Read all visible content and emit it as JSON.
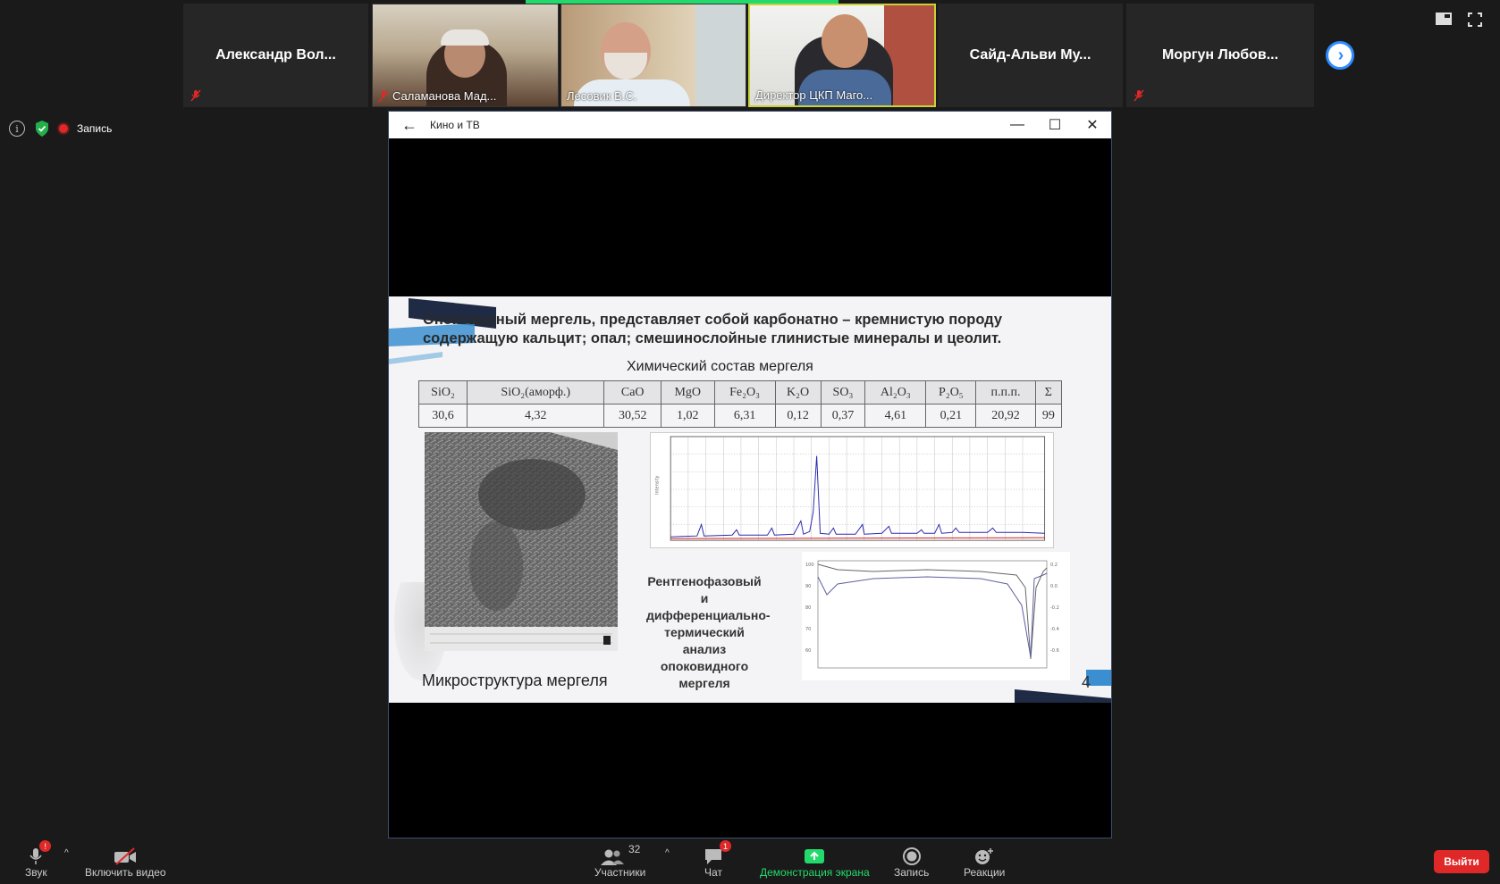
{
  "gallery": {
    "tiles": [
      {
        "name": "Александр  Вол...",
        "muted": true,
        "video": false
      },
      {
        "name": "Саламанова Мад...",
        "muted": true,
        "video": true
      },
      {
        "name": "Лесовик В.С.",
        "muted": false,
        "video": true
      },
      {
        "name": "Директор ЦКП Маго...",
        "muted": false,
        "video": true,
        "active_speaker": true
      },
      {
        "name": "Сайд-Альви  Му...",
        "muted": false,
        "video": false
      },
      {
        "name": "Моргун  Любов...",
        "muted": true,
        "video": false
      }
    ],
    "next_page_icon": "chevron-right-icon"
  },
  "recording": {
    "label": "Запись"
  },
  "share_window": {
    "title": "Кино и ТВ",
    "controls": [
      "minimize-icon",
      "maximize-icon",
      "close-icon"
    ]
  },
  "slide": {
    "title": "Опоковидный мергель, представляет собой карбонатно – кремнистую породу содержащую  кальцит; опал; смешинослойные глинистые минералы и  цеолит.",
    "table_title": "Химический  состав мергеля",
    "table": {
      "headers": [
        "SiO₂",
        "SiO₂(аморф.)",
        "CaO",
        "MgO",
        "Fe₂O₃",
        "K₂O",
        "SO₃",
        "Al₂O₃",
        "P₂O₅",
        "п.п.п.",
        "Σ"
      ],
      "values": [
        "30,6",
        "4,32",
        "30,52",
        "1,02",
        "6,31",
        "0,12",
        "0,37",
        "4,61",
        "0,21",
        "20,92",
        "99"
      ]
    },
    "analysis_caption": "Рентгенофазовый и дифференциально-термический анализ опоковидного мергеля",
    "micro_caption": "Микроструктура мергеля",
    "page_number": "4"
  },
  "toolbar": {
    "audio_label": "Звук",
    "audio_badge": "!",
    "video_label": "Включить видео",
    "participants_label": "Участники",
    "participants_count": "32",
    "chat_label": "Чат",
    "chat_badge": "1",
    "share_label": "Демонстрация экрана",
    "record_label": "Запись",
    "reactions_label": "Реакции",
    "leave_label": "Выйти",
    "share_color": "#23d96c",
    "leave_color": "#e02828"
  }
}
